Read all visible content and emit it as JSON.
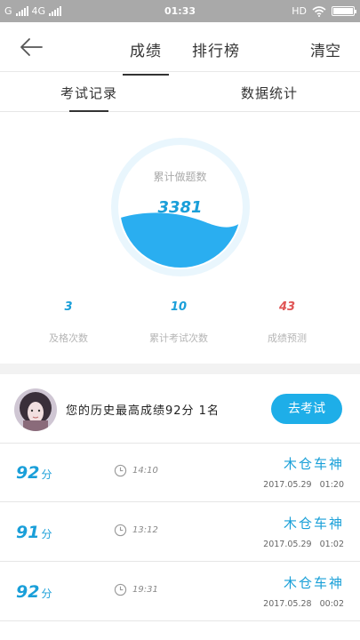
{
  "status_bar": {
    "carrier_left": "G",
    "network": "4G",
    "time": "01:33",
    "hd": "HD"
  },
  "header": {
    "tabs": [
      {
        "label": "成绩",
        "active": true
      },
      {
        "label": "排行榜",
        "active": false
      }
    ],
    "clear_label": "清空"
  },
  "subtabs": [
    {
      "label": "考试记录",
      "active": true
    },
    {
      "label": "数据统计",
      "active": false
    }
  ],
  "gauge": {
    "label": "累计做题数",
    "value": "3381",
    "fill_fraction": 0.42,
    "colors": {
      "ring": "#e8f5fc",
      "water": "#2aaef0",
      "bg": "#ffffff"
    }
  },
  "stats": [
    {
      "value": "3",
      "label": "及格次数",
      "color": "#1a9fd9"
    },
    {
      "value": "10",
      "label": "累计考试次数",
      "color": "#1a9fd9"
    },
    {
      "value": "43",
      "label": "成绩预测",
      "color": "#e05555"
    }
  ],
  "best": {
    "text": "您的历史最高成绩92分  1名",
    "button_label": "去考试"
  },
  "records": [
    {
      "score": "92",
      "unit": "分",
      "time": "14:10",
      "name": "木仓车神",
      "date": "2017.05.29   01:20"
    },
    {
      "score": "91",
      "unit": "分",
      "time": "13:12",
      "name": "木仓车神",
      "date": "2017.05.29   01:02"
    },
    {
      "score": "92",
      "unit": "分",
      "time": "19:31",
      "name": "木仓车神",
      "date": "2017.05.28   00:02"
    }
  ],
  "colors": {
    "accent": "#1a9fd9",
    "button": "#1eaee8",
    "warn": "#e05555"
  }
}
